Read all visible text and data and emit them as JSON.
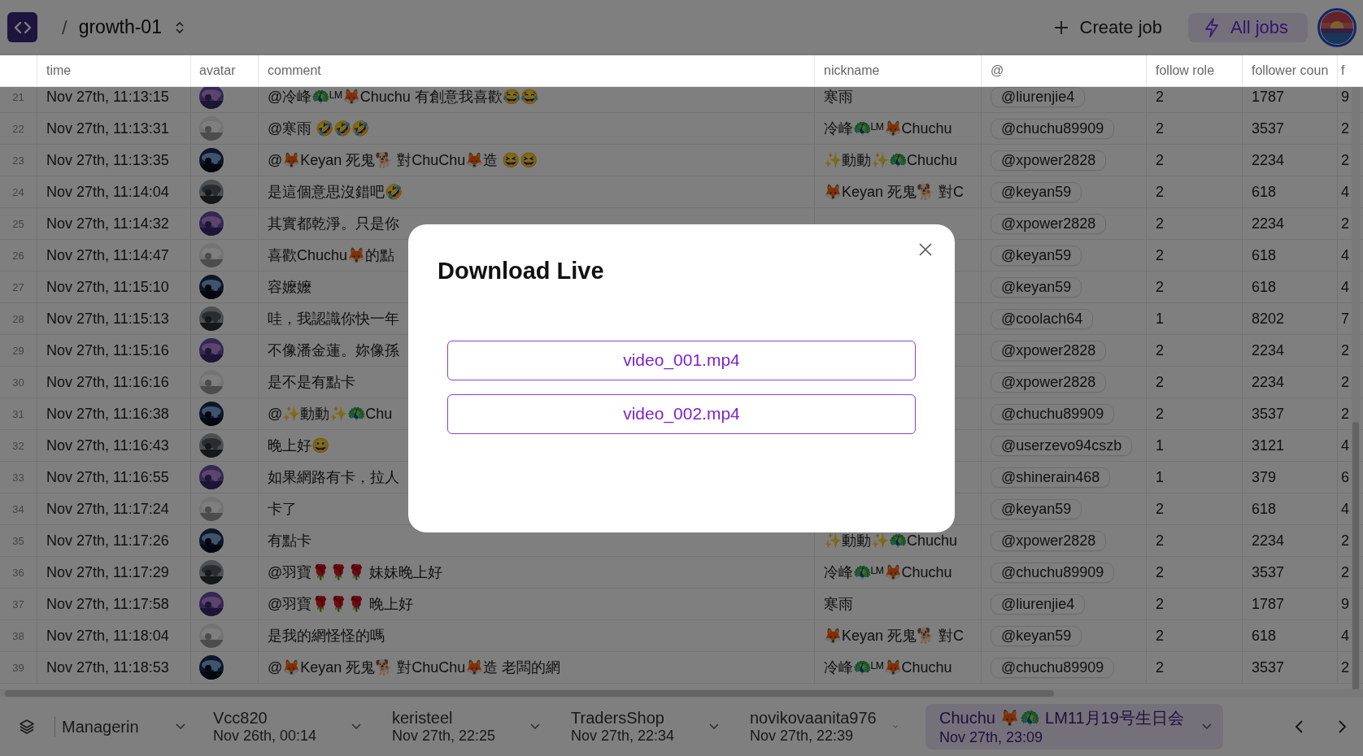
{
  "app": {
    "logo_separator": "/",
    "project": "growth-01"
  },
  "toolbar": {
    "create_job": "Create job",
    "all_jobs": "All jobs"
  },
  "table": {
    "columns": [
      "time",
      "avatar",
      "comment",
      "nickname",
      "@",
      "follow role",
      "follower coun",
      "f"
    ],
    "rows": [
      {
        "n": "21",
        "time": "Nov 27th, 11:13:15",
        "comment": "@冷峰🦚ᴸᴹ🦊Chuchu 有創意我喜歡😂😂",
        "nickname": "寒雨",
        "handle": "@liurenjie4",
        "follow_role": "2",
        "follower_count": "1787",
        "column_8": "9"
      },
      {
        "n": "22",
        "time": "Nov 27th, 11:13:31",
        "comment": "@寒雨 🤣🤣🤣",
        "nickname": "冷峰🦚ᴸᴹ🦊Chuchu",
        "handle": "@chuchu89909",
        "follow_role": "2",
        "follower_count": "3537",
        "column_8": "2"
      },
      {
        "n": "23",
        "time": "Nov 27th, 11:13:35",
        "comment": "@🦊Keyan 死鬼🐕 對ChuChu🦊造 😆😆",
        "nickname": "✨動動✨🦚Chuchu",
        "handle": "@xpower2828",
        "follow_role": "2",
        "follower_count": "2234",
        "column_8": "2"
      },
      {
        "n": "24",
        "time": "Nov 27th, 11:14:04",
        "comment": "是這個意思沒錯吧🤣",
        "nickname": "🦊Keyan 死鬼🐕 對C",
        "handle": "@keyan59",
        "follow_role": "2",
        "follower_count": "618",
        "column_8": "4"
      },
      {
        "n": "25",
        "time": "Nov 27th, 11:14:32",
        "comment": "其實都乾淨。只是你",
        "handle": "@xpower2828",
        "follow_role": "2",
        "follower_count": "2234",
        "column_8": "2"
      },
      {
        "n": "26",
        "time": "Nov 27th, 11:14:47",
        "comment": "喜歡Chuchu🦊的點",
        "handle": "@keyan59",
        "follow_role": "2",
        "follower_count": "618",
        "column_8": "4"
      },
      {
        "n": "27",
        "time": "Nov 27th, 11:15:10",
        "comment": "容嬤嬤",
        "handle": "@keyan59",
        "follow_role": "2",
        "follower_count": "618",
        "column_8": "4"
      },
      {
        "n": "28",
        "time": "Nov 27th, 11:15:13",
        "comment": "哇，我認識你快一年",
        "handle": "@coolach64",
        "follow_role": "1",
        "follower_count": "8202",
        "column_8": "7"
      },
      {
        "n": "29",
        "time": "Nov 27th, 11:15:16",
        "comment": "不像潘金蓮。妳像孫",
        "handle": "@xpower2828",
        "follow_role": "2",
        "follower_count": "2234",
        "column_8": "2"
      },
      {
        "n": "30",
        "time": "Nov 27th, 11:16:16",
        "comment": "是不是有點卡",
        "handle": "@xpower2828",
        "follow_role": "2",
        "follower_count": "2234",
        "column_8": "2"
      },
      {
        "n": "31",
        "time": "Nov 27th, 11:16:38",
        "comment": "@✨動動✨🦚Chu",
        "handle": "@chuchu89909",
        "follow_role": "2",
        "follower_count": "3537",
        "column_8": "2"
      },
      {
        "n": "32",
        "time": "Nov 27th, 11:16:43",
        "comment": "晚上好😀",
        "handle": "@userzevo94cszb",
        "follow_role": "1",
        "follower_count": "3121",
        "column_8": "4"
      },
      {
        "n": "33",
        "time": "Nov 27th, 11:16:55",
        "comment": "如果網路有卡，拉人",
        "handle": "@shinerain468",
        "follow_role": "1",
        "follower_count": "379",
        "column_8": "6"
      },
      {
        "n": "34",
        "time": "Nov 27th, 11:17:24",
        "comment": "卡了",
        "handle": "@keyan59",
        "follow_role": "2",
        "follower_count": "618",
        "column_8": "4"
      },
      {
        "n": "35",
        "time": "Nov 27th, 11:17:26",
        "comment": "有點卡",
        "nickname": "✨動動✨🦚Chuchu",
        "handle": "@xpower2828",
        "follow_role": "2",
        "follower_count": "2234",
        "column_8": "2"
      },
      {
        "n": "36",
        "time": "Nov 27th, 11:17:29",
        "comment": "@羽寶🌹🌹🌹 妹妹晚上好",
        "nickname": "冷峰🦚ᴸᴹ🦊Chuchu",
        "handle": "@chuchu89909",
        "follow_role": "2",
        "follower_count": "3537",
        "column_8": "2"
      },
      {
        "n": "37",
        "time": "Nov 27th, 11:17:58",
        "comment": "@羽寶🌹🌹🌹 晚上好",
        "nickname": "寒雨",
        "handle": "@liurenjie4",
        "follow_role": "2",
        "follower_count": "1787",
        "column_8": "9"
      },
      {
        "n": "38",
        "time": "Nov 27th, 11:18:04",
        "comment": "是我的網怪怪的嗎",
        "nickname": "🦊Keyan 死鬼🐕 對C",
        "handle": "@keyan59",
        "follow_role": "2",
        "follower_count": "618",
        "column_8": "4"
      },
      {
        "n": "39",
        "time": "Nov 27th, 11:18:53",
        "comment": "@🦊Keyan 死鬼🐕 對ChuChu🦊造 老闆的網",
        "nickname": "冷峰🦚ᴸᴹ🦊Chuchu",
        "handle": "@chuchu89909",
        "follow_role": "2",
        "follower_count": "3537",
        "column_8": "2"
      }
    ]
  },
  "bottom_tabs": [
    {
      "name": "Managerin",
      "selected": false
    },
    {
      "name": "Vcc820",
      "time": "Nov 26th, 00:14",
      "selected": false
    },
    {
      "name": "keristeel",
      "time": "Nov 27th, 22:25",
      "selected": false
    },
    {
      "name": "TradersShop",
      "time": "Nov 27th, 22:34",
      "selected": false
    },
    {
      "name": "novikovaanita976",
      "time": "Nov 27th, 22:39",
      "selected": false
    },
    {
      "name": "Chuchu 🦊🦚 LM11月19号生日会",
      "time": "Nov 27th, 23:09",
      "selected": true
    }
  ],
  "modal": {
    "title": "Download Live",
    "files": [
      "video_001.mp4",
      "video_002.mp4"
    ]
  }
}
